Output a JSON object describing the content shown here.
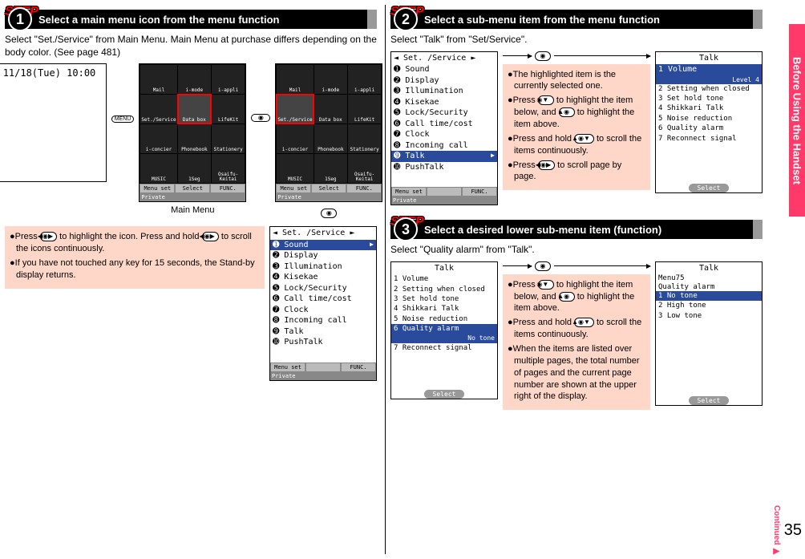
{
  "sideTab": "Before Using the Handset",
  "pageNumber": "35",
  "continued": "Continued",
  "steps": {
    "label": "STEP",
    "s1": {
      "num": "1",
      "title": "Select a main menu icon from the menu function",
      "body": "Select \"Set./Service\" from Main Menu. Main Menu at purchase differs depending on the body color. (See page 481)",
      "caption": "Main Menu",
      "standbyTime": "11/18(Tue) 10:00",
      "menuKey": "MENU",
      "gridItems": [
        "Mail",
        "i-mode",
        "i-appli",
        "Set./Service",
        "Data box",
        "LifeKit",
        "i-concier",
        "Phonebook",
        "Stationery",
        "MUSIC",
        "1Seg",
        "Osaifu-Keitai"
      ],
      "softLeft": "Menu set",
      "softMid": "Select",
      "softRight": "FUNC.",
      "privLabel": "Private",
      "serviceHeader": "◄   Set. /Service   ►",
      "serviceItems": [
        "➊ Sound",
        "➋ Display",
        "➌ Illumination",
        "➍ Kisekae",
        "➎ Lock/Security",
        "➏ Call time/cost",
        "➐ Clock",
        "➑ Incoming call",
        "➒ Talk",
        "➓ PushTalk"
      ],
      "softLeft2": "Menu set",
      "softRight2": "FUNC.",
      "hints": [
        "●Press {navH} to highlight the icon. Press and hold {navH} to scroll the icons continuously.",
        "●If you have not touched any key for 15 seconds, the Stand-by display returns."
      ]
    },
    "s2": {
      "num": "2",
      "title": "Select a sub-menu item from the menu function",
      "body": "Select \"Talk\" from \"Set/Service\".",
      "serviceHeader": "◄   Set. /Service   ►",
      "serviceItems": [
        "➊ Sound",
        "➋ Display",
        "➌ Illumination",
        "➍ Kisekae",
        "➎ Lock/Security",
        "➏ Call time/cost",
        "➐ Clock",
        "➑ Incoming call",
        "➒ Talk",
        "➓ PushTalk"
      ],
      "softLeft2": "Menu set",
      "softRight2": "FUNC.",
      "talkHeader": "Talk",
      "talkItems": [
        "1 Volume",
        "2 Setting when closed",
        "3 Set hold tone",
        "4 Shikkari Talk",
        "5 Noise reduction",
        "6 Quality alarm",
        "7 Reconnect signal"
      ],
      "talkLevel": "Level 4",
      "selectBtn": "Select",
      "hints": [
        "●The highlighted item is the currently selected one.",
        "●Press {navD} to highlight the item below, and {navU} to highlight the item above.",
        "●Press and hold {navV} to scroll the items continuously.",
        "●Press {navH} to scroll page by page."
      ]
    },
    "s3": {
      "num": "3",
      "title": "Select a desired lower sub-menu item (function)",
      "body": "Select \"Quality alarm\" from \"Talk\".",
      "talkHeader": "Talk",
      "talkItems": [
        "1 Volume",
        "2 Setting when closed",
        "3 Set hold tone",
        "4 Shikkari Talk",
        "5 Noise reduction",
        "6 Quality alarm",
        "7 Reconnect signal"
      ],
      "qaNote": "No tone",
      "selectBtn": "Select",
      "qHeader": "Talk",
      "qMenuNo": "Menu75",
      "qTitle": "Quality alarm",
      "qItems": [
        "1 No tone",
        "2 High tone",
        "3 Low tone"
      ],
      "hints": [
        "●Press {navD} to highlight the item below, and {navU} to highlight the item above.",
        "●Press and hold {navV} to scroll the items continuously.",
        "●When the items are listed over multiple pages, the total number of pages and the current page number are shown at the upper right of the display."
      ]
    }
  }
}
